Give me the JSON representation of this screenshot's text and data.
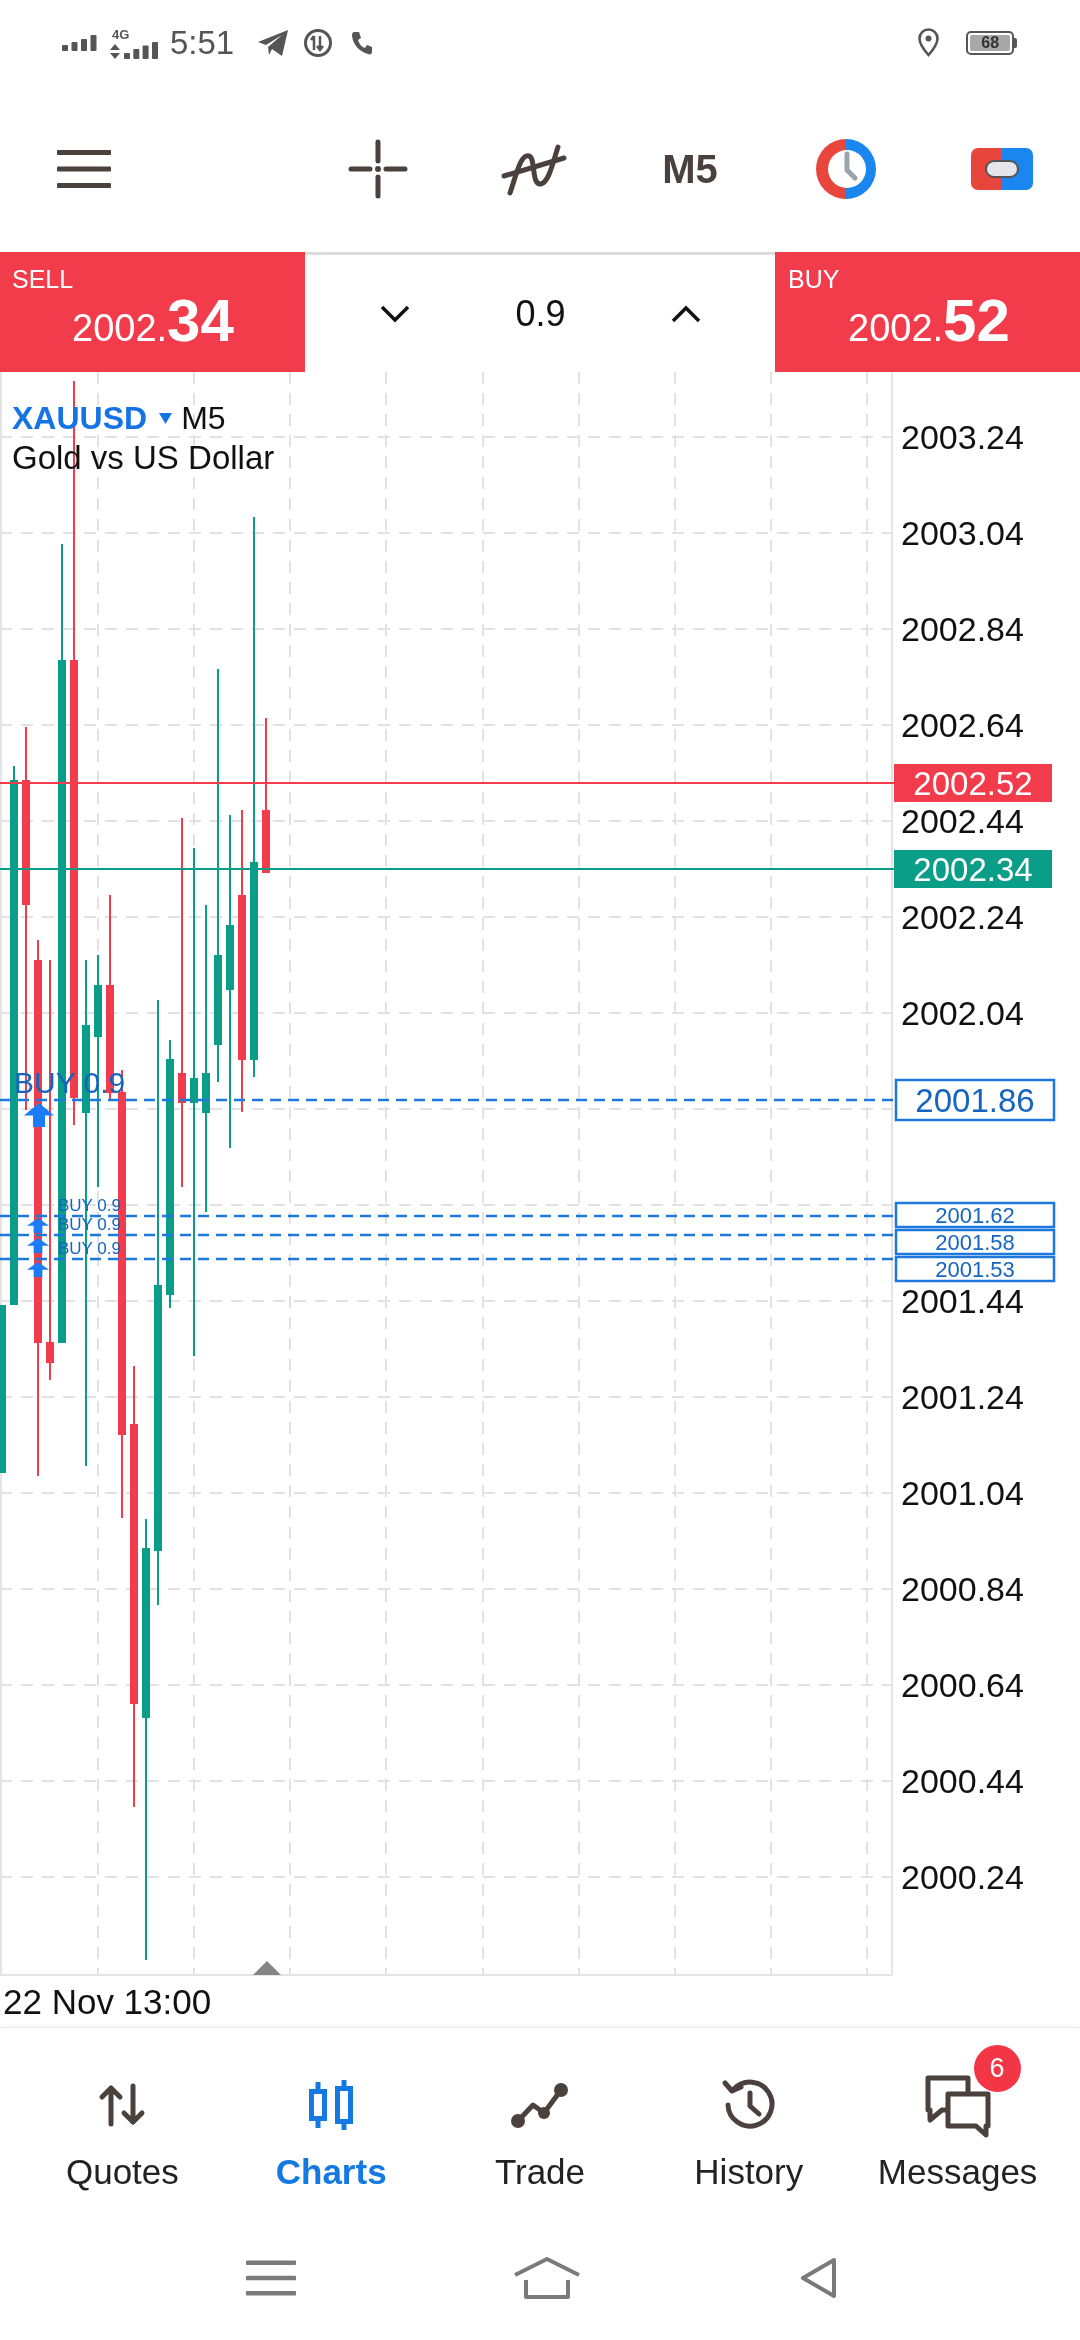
{
  "status_bar": {
    "network": "4G",
    "time": "5:51",
    "battery": "68"
  },
  "toolbar": {
    "timeframe": "M5"
  },
  "trade_bar": {
    "sell": {
      "label": "SELL",
      "price_head": "2002.",
      "price_tail": "34"
    },
    "volume": "0.9",
    "buy": {
      "label": "BUY",
      "price_head": "2002.",
      "price_tail": "52"
    }
  },
  "chart": {
    "symbol": "XAUUSD",
    "timeframe": "M5",
    "description": "Gold vs US Dollar",
    "price_ticks": [
      "2003.24",
      "2003.04",
      "2002.84",
      "2002.64",
      "2002.44",
      "2002.24",
      "2002.04",
      "2001.44",
      "2001.24",
      "2001.04",
      "2000.84",
      "2000.64",
      "2000.44",
      "2000.24"
    ],
    "ask_price": "2002.52",
    "bid_price": "2002.34",
    "orders": [
      {
        "label": "BUY 0.9",
        "price": "2001.86"
      },
      {
        "label": "BUY 0.9",
        "price": "2001.62"
      },
      {
        "label": "BUY 0.9",
        "price": "2001.58"
      },
      {
        "label": "BUY 0.9",
        "price": "2001.53"
      }
    ],
    "time_label": "22 Nov 13:00"
  },
  "bottom_nav": [
    {
      "label": "Quotes",
      "selected": false
    },
    {
      "label": "Charts",
      "selected": true
    },
    {
      "label": "Trade",
      "selected": false
    },
    {
      "label": "History",
      "selected": false
    },
    {
      "label": "Messages",
      "selected": false,
      "badge": "6"
    }
  ]
}
